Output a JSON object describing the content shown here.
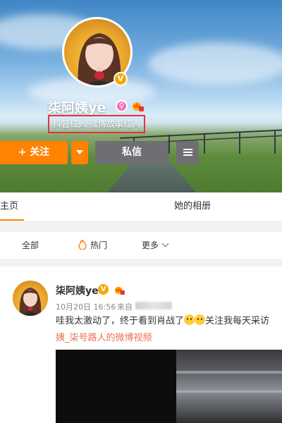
{
  "profile": {
    "name": "柒阿姨ye",
    "tags": "抖音红人 微博故事红人",
    "verified_badge": "V"
  },
  "actions": {
    "follow_label": "+ 关注",
    "message_label": "私信"
  },
  "tabs": [
    {
      "label": "主页"
    },
    {
      "label": "她的相册"
    }
  ],
  "filters": {
    "all_label": "全部",
    "hot_label": "热门",
    "more_label": "更多"
  },
  "post": {
    "author": "柒阿姨ye",
    "time": "10月20日 16:56",
    "source_prefix": "来自",
    "text_a": "哇我太激动了，终于看到肖战了",
    "text_b": "关注我每天采访",
    "link_text": "姨_柒号路人的微博视频"
  },
  "colors": {
    "accent": "#ff8200",
    "link": "#eb7350",
    "tag_border": "#e63434",
    "dark_button": "#6e6e73"
  },
  "icons": {
    "female": "female-icon",
    "vip": "vip-crown-icon",
    "hot": "fire-icon",
    "more": "chevron-down-icon",
    "menu": "hamburger-icon",
    "emoji": "sad-face-emoji"
  }
}
